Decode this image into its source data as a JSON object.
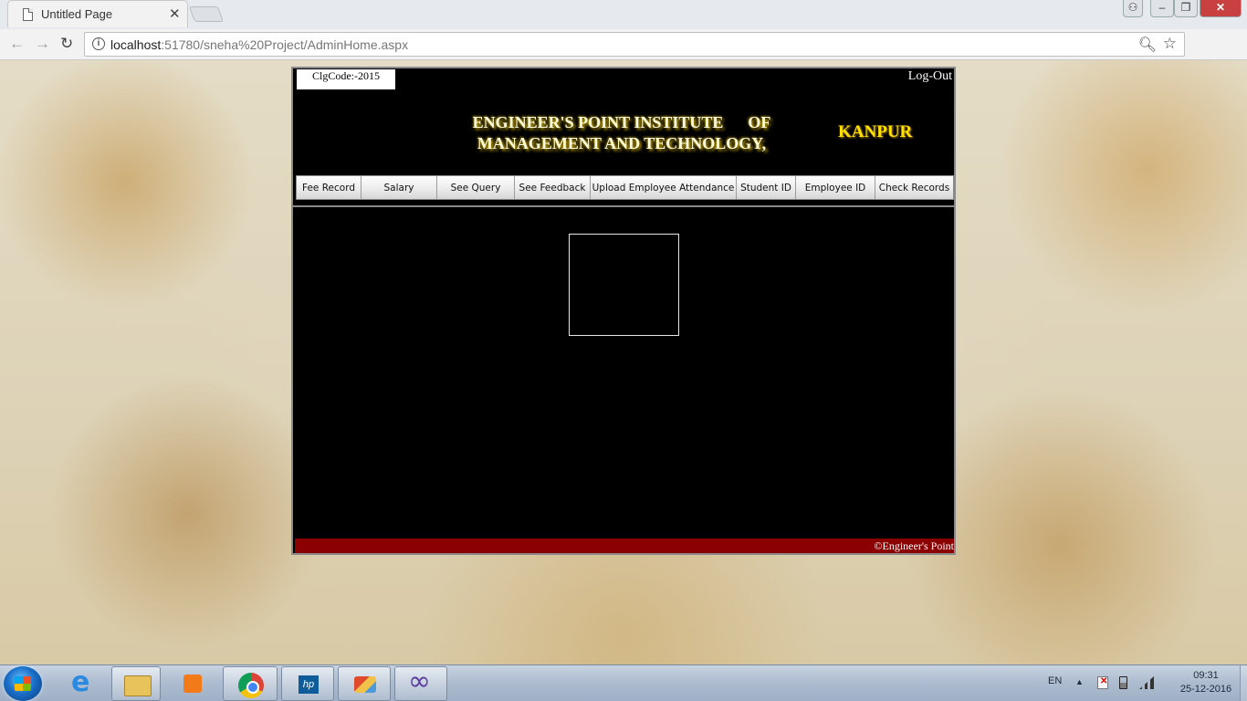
{
  "browser": {
    "tab_title": "Untitled Page",
    "tab_close": "✕",
    "url_host": "localhost",
    "url_rest": ":51780/sneha%20Project/AdminHome.aspx",
    "icons": [
      "page-icon",
      "back-icon",
      "forward-icon",
      "reload-icon",
      "info-icon",
      "zoom-icon",
      "star-icon",
      "extension-icon",
      "menu-icon"
    ]
  },
  "page": {
    "clg_code": "ClgCode:-2015",
    "logout": "Log-Out",
    "title": "ENGINEER'S POINT INSTITUTE      OF\nMANAGEMENT AND TECHNOLOGY,",
    "city": "KANPUR",
    "menu": [
      "Fee Record",
      "Salary",
      "See Query",
      "See Feedback",
      "Upload Employee Attendance",
      "Student ID",
      "Employee ID",
      "Check Records"
    ],
    "footer": "©Engineer's Point",
    "colors": {
      "panel": "#000000",
      "footer": "#8b0000",
      "title_glow": "#d2b200",
      "city": "#ffe000"
    }
  },
  "taskbar": {
    "lang": "EN",
    "time": "09:31",
    "date": "25-12-2016",
    "apps": [
      "internet-explorer-icon",
      "file-explorer-icon",
      "media-player-icon",
      "chrome-icon",
      "hp-icon",
      "paint-icon",
      "visual-studio-icon"
    ]
  }
}
